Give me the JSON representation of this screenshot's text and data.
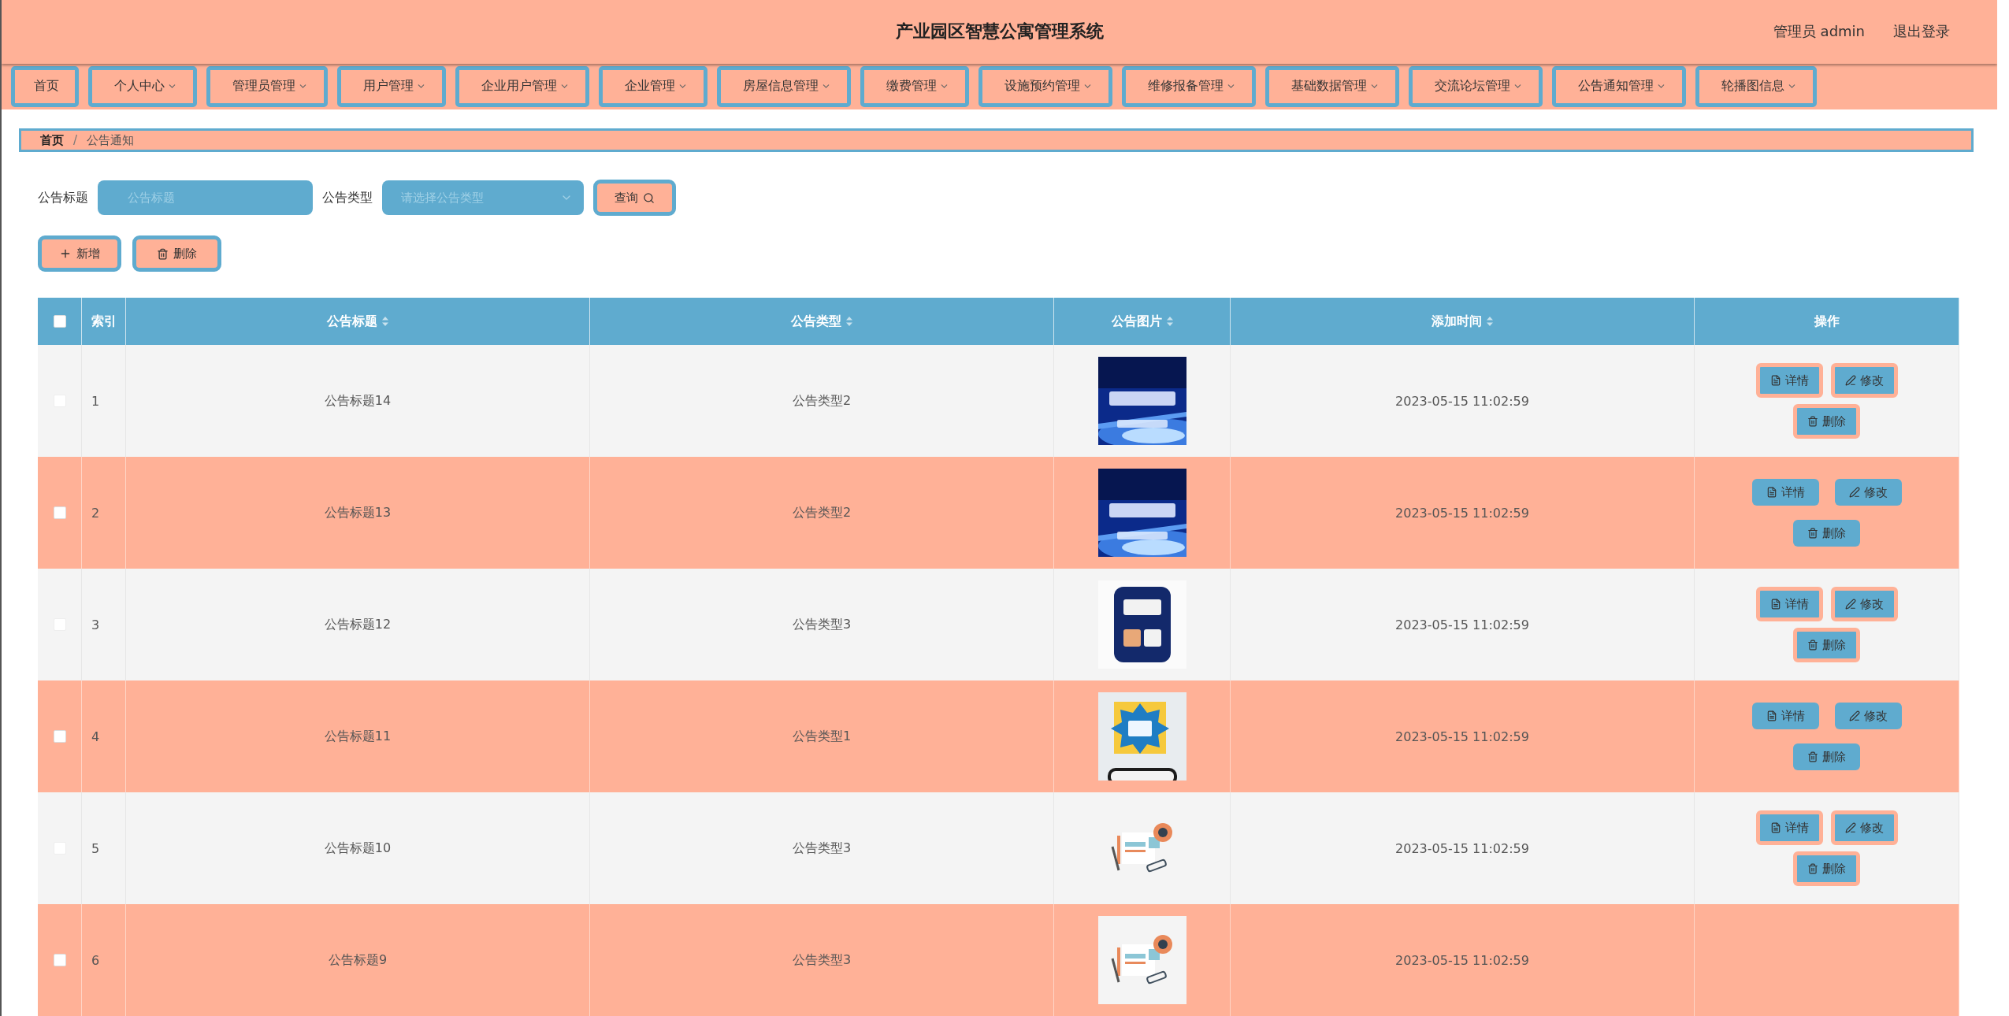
{
  "header": {
    "title": "产业园区智慧公寓管理系统",
    "user": "管理员 admin",
    "logout": "退出登录"
  },
  "nav": [
    {
      "label": "首页",
      "dropdown": false
    },
    {
      "label": "个人中心",
      "dropdown": true
    },
    {
      "label": "管理员管理",
      "dropdown": true
    },
    {
      "label": "用户管理",
      "dropdown": true
    },
    {
      "label": "企业用户管理",
      "dropdown": true
    },
    {
      "label": "企业管理",
      "dropdown": true
    },
    {
      "label": "房屋信息管理",
      "dropdown": true
    },
    {
      "label": "缴费管理",
      "dropdown": true
    },
    {
      "label": "设施预约管理",
      "dropdown": true
    },
    {
      "label": "维修报备管理",
      "dropdown": true
    },
    {
      "label": "基础数据管理",
      "dropdown": true
    },
    {
      "label": "交流论坛管理",
      "dropdown": true
    },
    {
      "label": "公告通知管理",
      "dropdown": true
    },
    {
      "label": "轮播图信息",
      "dropdown": true
    }
  ],
  "breadcrumb": {
    "items": [
      "首页",
      "公告通知"
    ],
    "separator": "/"
  },
  "search": {
    "title_label": "公告标题",
    "title_placeholder": "公告标题",
    "type_label": "公告类型",
    "type_placeholder": "请选择公告类型",
    "query_button": "查询"
  },
  "actions": {
    "add": "新增",
    "delete": "删除"
  },
  "table": {
    "select_all_checked": false,
    "columns": [
      {
        "label": "索引",
        "sortable": false
      },
      {
        "label": "公告标题",
        "sortable": true
      },
      {
        "label": "公告类型",
        "sortable": true
      },
      {
        "label": "公告图片",
        "sortable": true
      },
      {
        "label": "添加时间",
        "sortable": true
      },
      {
        "label": "操作",
        "sortable": false
      }
    ],
    "rows": [
      {
        "index": "1",
        "title": "公告标题14",
        "type": "公告类型2",
        "time": "2023-05-15 11:02:59",
        "striped": false,
        "checked": false,
        "actions": [
          "详情",
          "修改",
          "删除"
        ]
      },
      {
        "index": "2",
        "title": "公告标题13",
        "type": "公告类型2",
        "time": "2023-05-15 11:02:59",
        "striped": true,
        "checked": false,
        "actions": [
          "详情",
          "修改",
          "删除"
        ]
      },
      {
        "index": "3",
        "title": "公告标题12",
        "type": "公告类型3",
        "time": "2023-05-15 11:02:59",
        "striped": false,
        "checked": false,
        "actions": [
          "详情",
          "修改",
          "删除"
        ]
      },
      {
        "index": "4",
        "title": "公告标题11",
        "type": "公告类型1",
        "time": "2023-05-15 11:02:59",
        "striped": true,
        "checked": false,
        "actions": [
          "详情",
          "修改",
          "删除"
        ]
      },
      {
        "index": "5",
        "title": "公告标题10",
        "type": "公告类型3",
        "time": "2023-05-15 11:02:59",
        "striped": false,
        "checked": false,
        "actions": [
          "详情",
          "修改",
          "删除"
        ]
      },
      {
        "index": "6",
        "title": "公告标题9",
        "type": "公告类型3",
        "time": "2023-05-15 11:02:59",
        "striped": true,
        "checked": false
      }
    ]
  }
}
